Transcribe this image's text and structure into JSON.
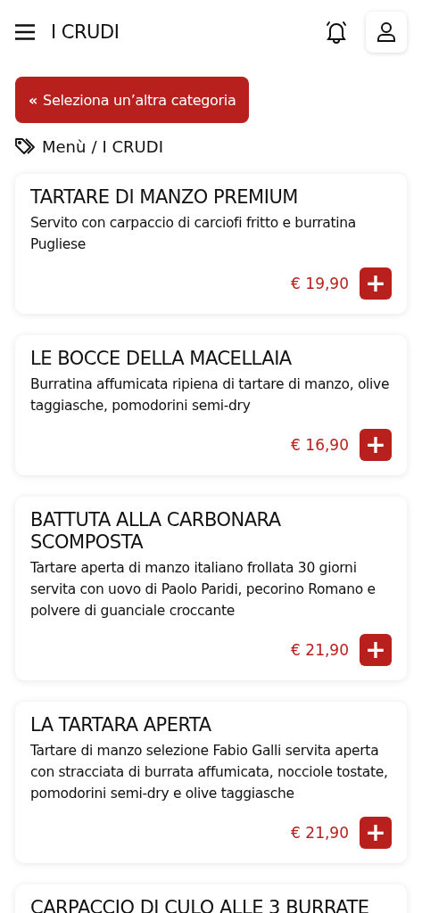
{
  "header": {
    "title": "I CRUDI"
  },
  "back_button": {
    "label": "Seleziona un’altra categoria",
    "icon": "«"
  },
  "breadcrumb": {
    "items": [
      "Menù",
      "I CRUDI"
    ],
    "separator": "/"
  },
  "dishes": [
    {
      "name": "TARTARE DI MANZO PREMIUM",
      "description": "Servito con carpaccio di carciofi fritto e burratina Pugliese",
      "price": "€ 19,90",
      "add": "+"
    },
    {
      "name": "LE BOCCE DELLA MACELLAIA",
      "description": "Burratina affumicata ripiena di tartare di manzo, olive taggiasche, pomodorini semi-dry",
      "price": "€ 16,90",
      "add": "+"
    },
    {
      "name": "BATTUTA ALLA CARBONARA SCOMPOSTA",
      "description": "Tartare aperta di manzo italiano frollata 30 giorni servita con uovo di Paolo Paridi, pecorino Romano e polvere di guanciale croccante",
      "price": "€ 21,90",
      "add": "+"
    },
    {
      "name": "LA TARTARA APERTA",
      "description": "Tartare di manzo selezione Fabio Galli servita aperta con stracciata di burrata affumicata, nocciole tostate, pomodorini semi-dry e olive taggiasche",
      "price": "€ 21,90",
      "add": "+"
    },
    {
      "name": "CARPACCIO DI CULO ALLE 3 BURRATE"
    }
  ]
}
